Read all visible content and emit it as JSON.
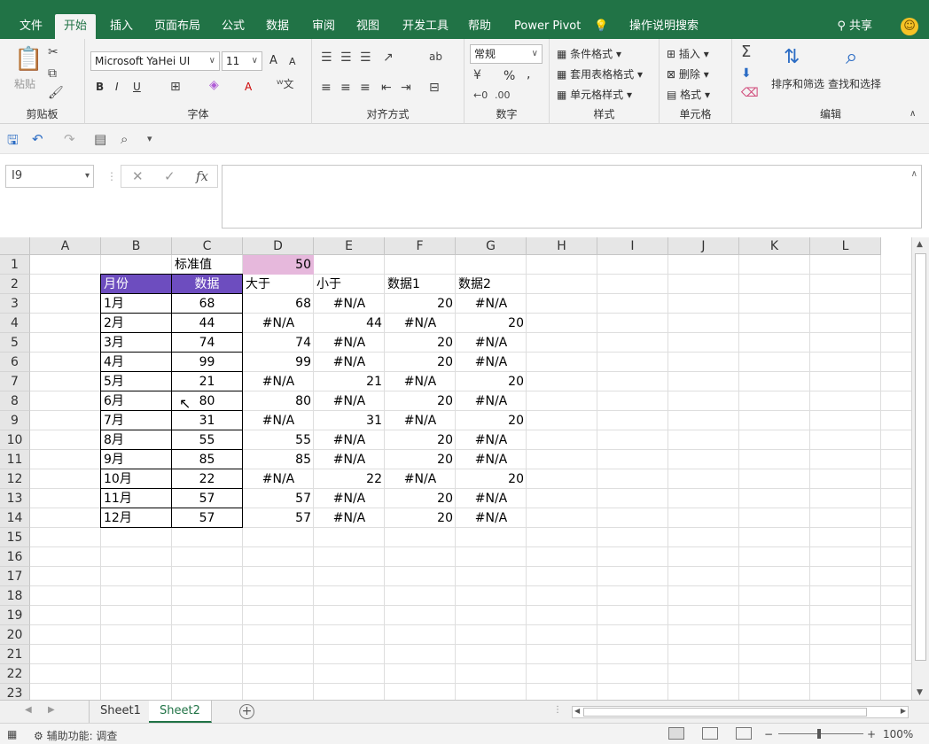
{
  "ribbon_tabs": [
    {
      "label": "文件"
    },
    {
      "label": "开始",
      "active": true
    },
    {
      "label": "插入"
    },
    {
      "label": "页面布局"
    },
    {
      "label": "公式"
    },
    {
      "label": "数据"
    },
    {
      "label": "审阅"
    },
    {
      "label": "视图"
    },
    {
      "label": "开发工具"
    },
    {
      "label": "帮助"
    },
    {
      "label": "Power Pivot"
    },
    {
      "label": "操作说明搜索"
    }
  ],
  "share_label": "共享",
  "colors": {
    "brand": "#217346",
    "header_fill": "#6d4dbf",
    "header_text": "#ffffff",
    "standard_fill": "#e6b8dc"
  },
  "clipboard": {
    "paste": "粘贴",
    "group": "剪贴板"
  },
  "font": {
    "name": "Microsoft YaHei UI",
    "size": "11",
    "group": "字体",
    "bold": "B",
    "italic": "I",
    "underline": "U",
    "grow": "A",
    "shrink": "A",
    "color_a": "A"
  },
  "alignment": {
    "group": "对齐方式"
  },
  "number": {
    "format": "常规",
    "group": "数字",
    "percent": "%",
    "comma": ","
  },
  "styles": {
    "conditional": "条件格式",
    "table": "套用表格格式",
    "cell": "单元格样式",
    "group": "样式"
  },
  "cells": {
    "insert": "插入",
    "delete": "删除",
    "format": "格式",
    "group": "单元格"
  },
  "editing": {
    "sort": "排序和筛选",
    "find": "查找和选择",
    "group": "编辑"
  },
  "namebox": "I9",
  "formula_value": "",
  "columns": [
    "A",
    "B",
    "C",
    "D",
    "E",
    "F",
    "G",
    "H",
    "I",
    "J",
    "K",
    "L"
  ],
  "row_numbers": [
    "1",
    "2",
    "3",
    "4",
    "5",
    "6",
    "7",
    "8",
    "9",
    "10",
    "11",
    "12",
    "13",
    "14",
    "15",
    "16",
    "17",
    "18",
    "19",
    "20",
    "21",
    "22",
    "23"
  ],
  "sheet": {
    "c1_label": "标准值",
    "d1_value": "50",
    "headers": {
      "b": "月份",
      "c": "数据",
      "d": "大于",
      "e": "小于",
      "f": "数据1",
      "g": "数据2"
    },
    "rows": [
      {
        "month": "1月",
        "data": "68",
        "gt": "68",
        "lt": "#N/A",
        "d1": "20",
        "d2": "#N/A"
      },
      {
        "month": "2月",
        "data": "44",
        "gt": "#N/A",
        "lt": "44",
        "d1": "#N/A",
        "d2": "20"
      },
      {
        "month": "3月",
        "data": "74",
        "gt": "74",
        "lt": "#N/A",
        "d1": "20",
        "d2": "#N/A"
      },
      {
        "month": "4月",
        "data": "99",
        "gt": "99",
        "lt": "#N/A",
        "d1": "20",
        "d2": "#N/A"
      },
      {
        "month": "5月",
        "data": "21",
        "gt": "#N/A",
        "lt": "21",
        "d1": "#N/A",
        "d2": "20"
      },
      {
        "month": "6月",
        "data": "80",
        "gt": "80",
        "lt": "#N/A",
        "d1": "20",
        "d2": "#N/A"
      },
      {
        "month": "7月",
        "data": "31",
        "gt": "#N/A",
        "lt": "31",
        "d1": "#N/A",
        "d2": "20"
      },
      {
        "month": "8月",
        "data": "55",
        "gt": "55",
        "lt": "#N/A",
        "d1": "20",
        "d2": "#N/A"
      },
      {
        "month": "9月",
        "data": "85",
        "gt": "85",
        "lt": "#N/A",
        "d1": "20",
        "d2": "#N/A"
      },
      {
        "month": "10月",
        "data": "22",
        "gt": "#N/A",
        "lt": "22",
        "d1": "#N/A",
        "d2": "20"
      },
      {
        "month": "11月",
        "data": "57",
        "gt": "57",
        "lt": "#N/A",
        "d1": "20",
        "d2": "#N/A"
      },
      {
        "month": "12月",
        "data": "57",
        "gt": "57",
        "lt": "#N/A",
        "d1": "20",
        "d2": "#N/A"
      }
    ]
  },
  "sheet_tabs": [
    {
      "label": "Sheet1"
    },
    {
      "label": "Sheet2",
      "active": true
    }
  ],
  "status": {
    "accessibility": "辅助功能: 调查",
    "zoom": "100%"
  }
}
